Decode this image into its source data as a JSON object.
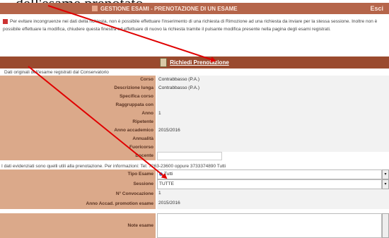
{
  "caption": "... dell'esame prenotato.",
  "window": {
    "title": "GESTIONE ESAMI - PRENOTAZIONE DI UN ESAME",
    "close": "Esci"
  },
  "notice": "Per evitare incongruenze nei dati della richiesta, non è possibile effettuare l'inserimento di una richiesta di Rimozione ad una richiesta da inviare per la stessa sessione. Inoltre non è possibile effettuare la modifica, chiudere questa finestra ed effettuare di nuovo la richiesta tramite il pulsante modifica presente nella pagina degli esami registrati.",
  "section": {
    "title": "Richiedi Prenotazione",
    "icon": "document-icon"
  },
  "subheader1": "Dati originali dell'esame registrati dal Conservatorio",
  "fields": [
    {
      "label": "Corso",
      "value": "Contrabbasso (P.A.)"
    },
    {
      "label": "Descrizione lunga",
      "value": "Contrabbasso (P.A.)"
    },
    {
      "label": "Specifica corso",
      "value": ""
    },
    {
      "label": "Raggruppata con",
      "value": ""
    },
    {
      "label": "Anno",
      "value": "1"
    },
    {
      "label": "Ripetente",
      "value": ""
    },
    {
      "label": "Anno accademico",
      "value": "2015/2016"
    },
    {
      "label": "Annualità",
      "value": ""
    },
    {
      "label": "Fuoricorso",
      "value": ""
    },
    {
      "label": "Docente",
      "value": ""
    }
  ],
  "subheader2": "I dati evidenziati sono quelli utili alla prenotazione. Per informazioni: Tel: 7263-23600 oppure 3733374890 Tutti",
  "fields2": [
    {
      "label": "Tipo Esame",
      "value": "Tutti",
      "type": "select"
    },
    {
      "label": "Sessione",
      "value": "TUTTE",
      "type": "select"
    },
    {
      "label": "N° Convocazione",
      "value": "1",
      "type": "text"
    },
    {
      "label": "Anno Accad. promotion esame",
      "value": "2015/2016",
      "type": "text"
    }
  ],
  "note_label": "Note esame",
  "colors": {
    "title_bar": "#b5654a",
    "section_bar": "#9a4a2e",
    "label_bg": "#dba98a",
    "annotation_arrow": "#e00000"
  }
}
